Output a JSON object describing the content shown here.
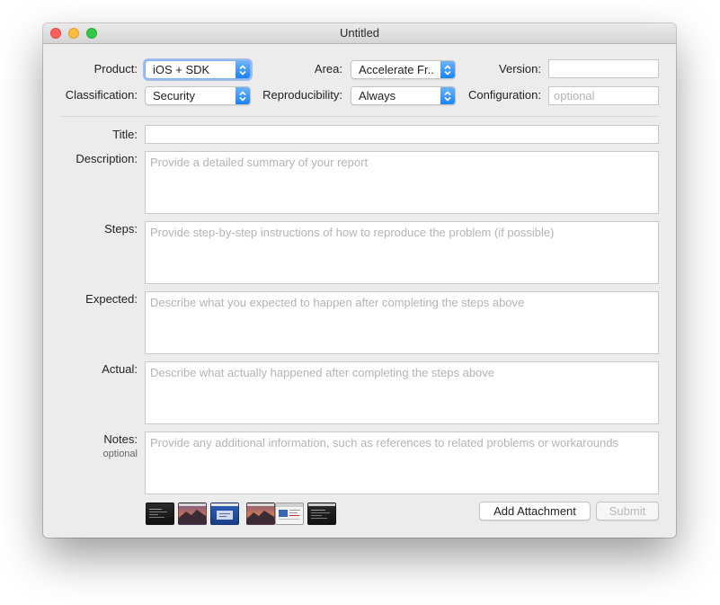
{
  "window": {
    "title": "Untitled"
  },
  "form": {
    "product": {
      "label": "Product:",
      "value": "iOS + SDK"
    },
    "area": {
      "label": "Area:",
      "value": "Accelerate Fr..."
    },
    "version": {
      "label": "Version:",
      "value": "",
      "placeholder": ""
    },
    "classification": {
      "label": "Classification:",
      "value": "Security"
    },
    "reproducibility": {
      "label": "Reproducibility:",
      "value": "Always"
    },
    "configuration": {
      "label": "Configuration:",
      "value": "",
      "placeholder": "optional"
    },
    "title": {
      "label": "Title:",
      "value": ""
    },
    "description": {
      "label": "Description:",
      "placeholder": "Provide a detailed summary of your report"
    },
    "steps": {
      "label": "Steps:",
      "placeholder": "Provide step-by-step instructions of how to reproduce the problem (if possible)"
    },
    "expected": {
      "label": "Expected:",
      "placeholder": "Describe what you expected to happen after completing the steps above"
    },
    "actual": {
      "label": "Actual:",
      "placeholder": "Describe what actually happened after completing the steps above"
    },
    "notes": {
      "label": "Notes:",
      "sublabel": "optional",
      "placeholder": "Provide any additional information, such as references to related problems or workarounds"
    }
  },
  "attachments": [
    {
      "name": "terminal-screenshot-1"
    },
    {
      "name": "sierra-wallpaper-1"
    },
    {
      "name": "blue-window-screenshot"
    },
    {
      "name": "sierra-wallpaper-2"
    },
    {
      "name": "browser-window-screenshot"
    },
    {
      "name": "terminal-screenshot-2"
    }
  ],
  "buttons": {
    "add_attachment": "Add Attachment",
    "submit": "Submit"
  },
  "colors": {
    "accent": "#1a82fb",
    "close": "#fc605c",
    "minimize": "#fdbc40",
    "maximize": "#34c84a"
  }
}
